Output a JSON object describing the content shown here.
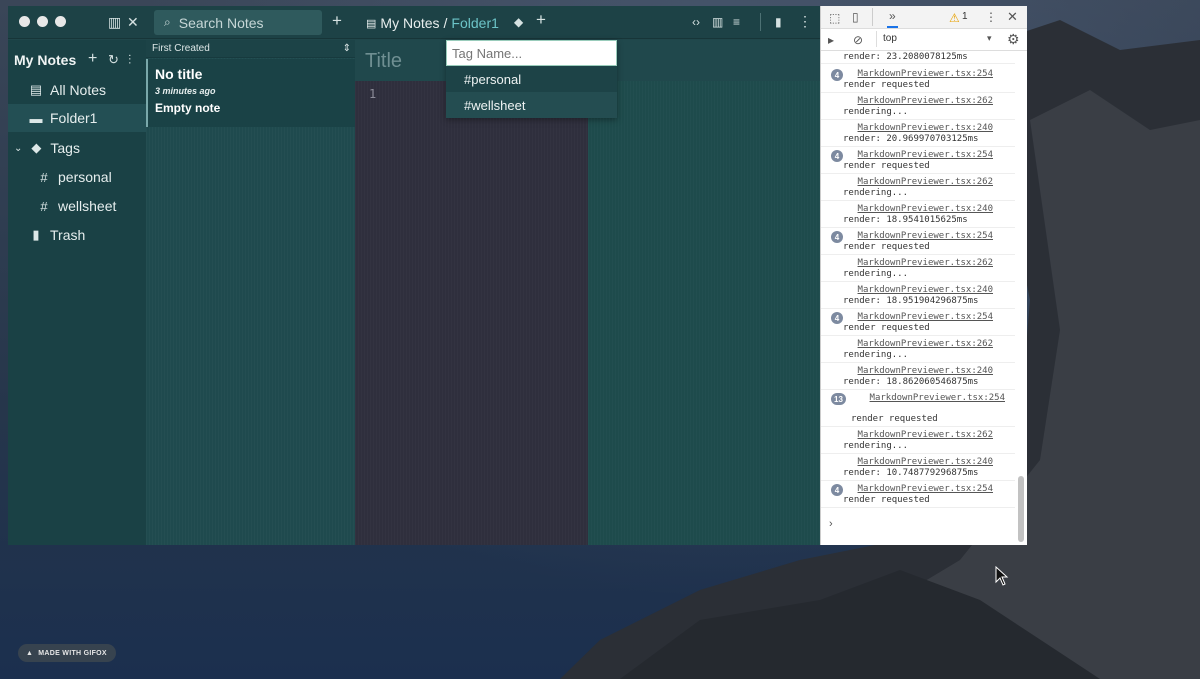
{
  "watermark": "MADE WITH GIFOX",
  "app": {
    "search_placeholder": "Search Notes",
    "breadcrumb": {
      "root": "My Notes",
      "sep": "/",
      "current": "Folder1"
    },
    "sidebar": {
      "title": "My Notes",
      "items": [
        {
          "label": "All Notes",
          "icon": "book-icon"
        },
        {
          "label": "Folder1",
          "icon": "folder-icon"
        },
        {
          "label": "Tags",
          "icon": "tag-icon"
        },
        {
          "label": "personal",
          "icon": "hash-icon"
        },
        {
          "label": "wellsheet",
          "icon": "hash-icon"
        },
        {
          "label": "Trash",
          "icon": "trash-icon"
        }
      ]
    },
    "notelist": {
      "sort_label": "First Created",
      "note": {
        "title": "No title",
        "time": "3 minutes ago",
        "body": "Empty note"
      }
    },
    "editor": {
      "title_placeholder": "Title",
      "line_number": "1"
    },
    "tag_popup": {
      "placeholder": "Tag Name...",
      "options": [
        "personal",
        "wellsheet"
      ]
    }
  },
  "devtools": {
    "warning_count": "1",
    "context": "top",
    "top_log": "render: 23.2080078125ms",
    "logs": [
      {
        "badge": "4",
        "src": "MarkdownPreviewer.tsx:254",
        "msg": "render requested"
      },
      {
        "badge": "",
        "src": "MarkdownPreviewer.tsx:262",
        "msg": "rendering..."
      },
      {
        "badge": "",
        "src": "MarkdownPreviewer.tsx:240",
        "msg": "render: 20.969970703125ms"
      },
      {
        "badge": "4",
        "src": "MarkdownPreviewer.tsx:254",
        "msg": "render requested"
      },
      {
        "badge": "",
        "src": "MarkdownPreviewer.tsx:262",
        "msg": "rendering..."
      },
      {
        "badge": "",
        "src": "MarkdownPreviewer.tsx:240",
        "msg": "render: 18.9541015625ms"
      },
      {
        "badge": "4",
        "src": "MarkdownPreviewer.tsx:254",
        "msg": "render requested"
      },
      {
        "badge": "",
        "src": "MarkdownPreviewer.tsx:262",
        "msg": "rendering..."
      },
      {
        "badge": "",
        "src": "MarkdownPreviewer.tsx:240",
        "msg": "render: 18.951904296875ms"
      },
      {
        "badge": "4",
        "src": "MarkdownPreviewer.tsx:254",
        "msg": "render requested"
      },
      {
        "badge": "",
        "src": "MarkdownPreviewer.tsx:262",
        "msg": "rendering..."
      },
      {
        "badge": "",
        "src": "MarkdownPreviewer.tsx:240",
        "msg": "render: 18.862060546875ms"
      },
      {
        "badge": "13",
        "src": "MarkdownPreviewer.tsx:254",
        "msg": "render requested"
      },
      {
        "badge": "",
        "src": "MarkdownPreviewer.tsx:262",
        "msg": "rendering..."
      },
      {
        "badge": "",
        "src": "MarkdownPreviewer.tsx:240",
        "msg": "render: 10.748779296875ms"
      },
      {
        "badge": "4",
        "src": "MarkdownPreviewer.tsx:254",
        "msg": "render requested"
      }
    ]
  }
}
